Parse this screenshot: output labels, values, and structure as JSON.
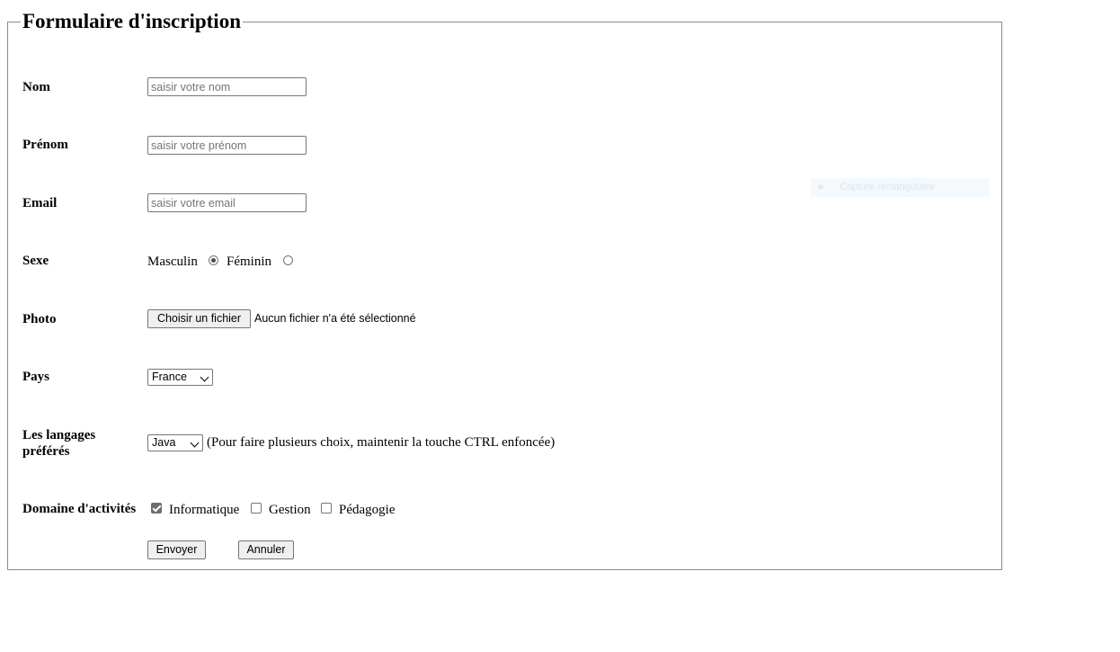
{
  "form": {
    "legend": "Formulaire d'inscription",
    "nom": {
      "label": "Nom",
      "placeholder": "saisir votre nom"
    },
    "prenom": {
      "label": "Prénom",
      "placeholder": "saisir votre prénom"
    },
    "email": {
      "label": "Email",
      "placeholder": "saisir votre email"
    },
    "sexe": {
      "label": "Sexe",
      "options": [
        "Masculin",
        "Féminin"
      ],
      "selected": "Masculin"
    },
    "photo": {
      "label": "Photo",
      "button_label": "Choisir un fichier",
      "status": "Aucun fichier n'a été sélectionné"
    },
    "pays": {
      "label": "Pays",
      "selected": "France"
    },
    "langages": {
      "label_line1": "Les langages",
      "label_line2": "préférés",
      "selected": "Java",
      "hint": "(Pour faire plusieurs choix, maintenir la touche CTRL enfoncée)"
    },
    "domaine": {
      "label": "Domaine d'activités",
      "options": [
        {
          "label": "Informatique",
          "checked": true
        },
        {
          "label": "Gestion",
          "checked": false
        },
        {
          "label": "Pédagogie",
          "checked": false
        }
      ]
    },
    "submit_label": "Envoyer",
    "reset_label": "Annuler"
  },
  "overlay": {
    "text": "Capture rectangulaire"
  }
}
